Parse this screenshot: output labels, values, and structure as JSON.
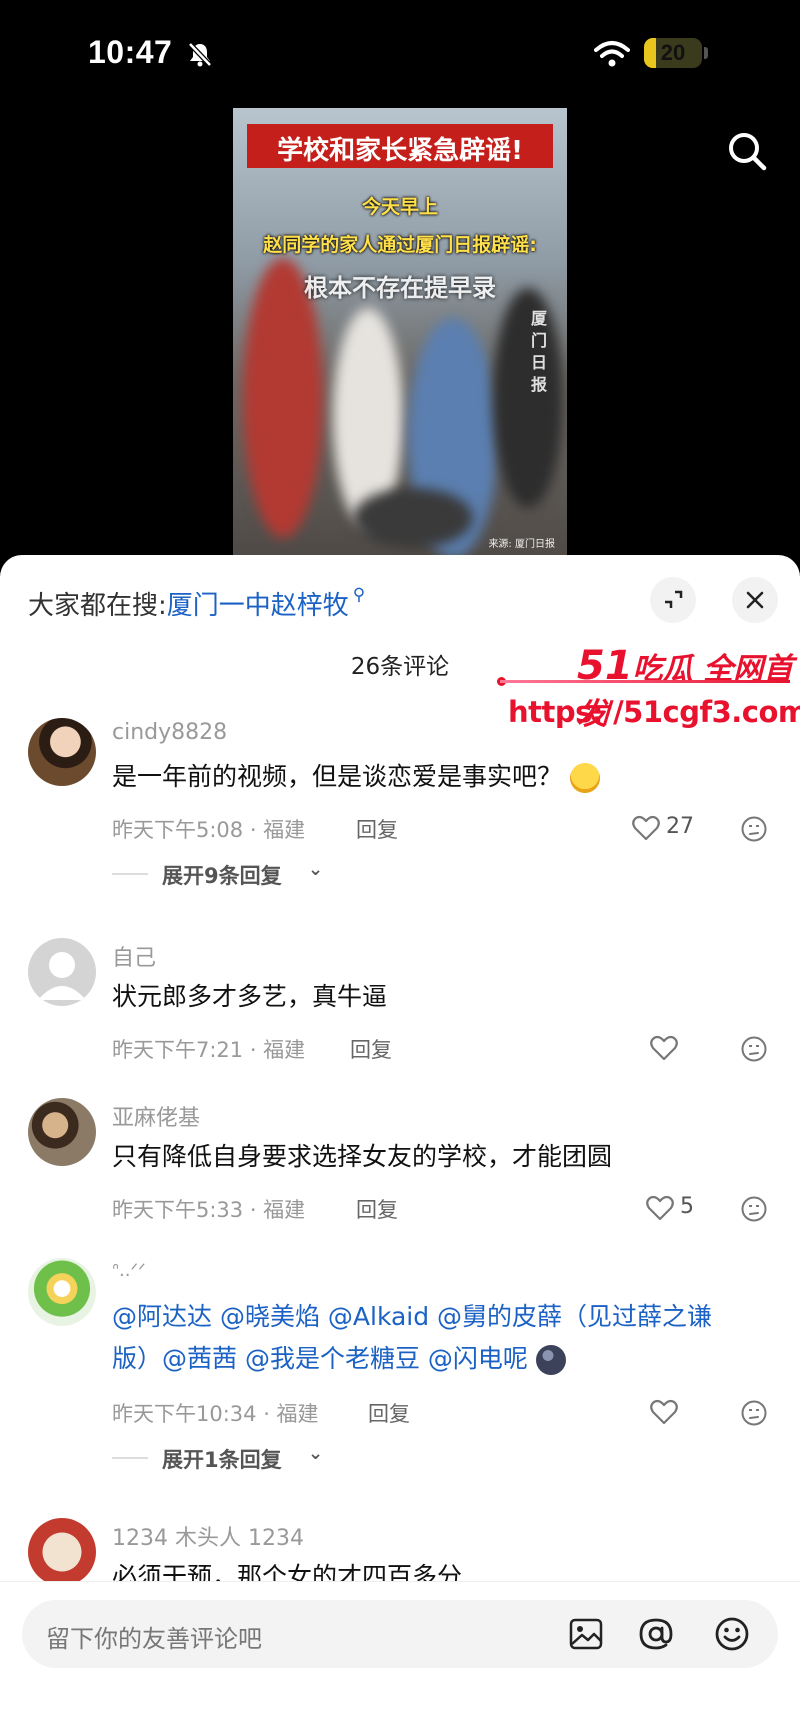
{
  "status_bar": {
    "time": "10:47",
    "battery": "20",
    "battery_level": 0.2,
    "icons": [
      "bell-off-icon",
      "wifi-icon",
      "battery-icon"
    ]
  },
  "video": {
    "title": "学校和家长紧急辟谣!",
    "caption_1": "今天早上",
    "caption_2": "赵同学的家人通过厦门日报辟谣:",
    "caption_3": "根本不存在提早录",
    "side_text": "厦门日报",
    "source": "来源: 厦门日报"
  },
  "sheet": {
    "hot_search_prefix": "大家都在搜:",
    "hot_search_term": "厦门一中赵梓牧",
    "comment_count": "26条评论"
  },
  "watermark": {
    "brand_number": "51",
    "brand_text": "吃瓜 全网首发",
    "url": "https://51cgf3.com"
  },
  "comments": [
    {
      "user": "cindy8828",
      "text": "是一年前的视频，但是谈恋爱是事实吧？",
      "meta": "昨天下午5:08 · 福建",
      "reply_label": "回复",
      "likes": "27",
      "expand": "展开9条回复"
    },
    {
      "user": "自己",
      "text": "状元郎多才多艺，真牛逼",
      "meta": "昨天下午7:21 · 福建",
      "reply_label": "回复",
      "likes": ""
    },
    {
      "user": "亚麻佬基",
      "text": "只有降低自身要求选择女友的学校，才能团圆",
      "meta": "昨天下午5:33 · 福建",
      "reply_label": "回复",
      "likes": "5"
    },
    {
      "user": "ᐢ..ᐟᐟ",
      "mentions_line1": "@阿达达 @晓美焰 @Alkaid @舅的皮薛（见过薛之谦",
      "mentions_line2a": "版）",
      "mentions_line2b": "@茜茜 @我是个老糖豆 @闪电呢",
      "meta": "昨天下午10:34 · 福建",
      "reply_label": "回复",
      "likes": "",
      "expand": "展开1条回复"
    },
    {
      "user": "1234 木头人 1234",
      "text": "必须干预，那个女的才四百多分"
    }
  ],
  "bottom_bar": {
    "placeholder": "留下你的友善评论吧",
    "icons": [
      "image-icon",
      "at-icon",
      "emoji-icon"
    ]
  },
  "colors": {
    "accent_blue": "#1c62c4",
    "watermark_red": "#e8122e",
    "battery_yellow": "#e8c61d"
  }
}
